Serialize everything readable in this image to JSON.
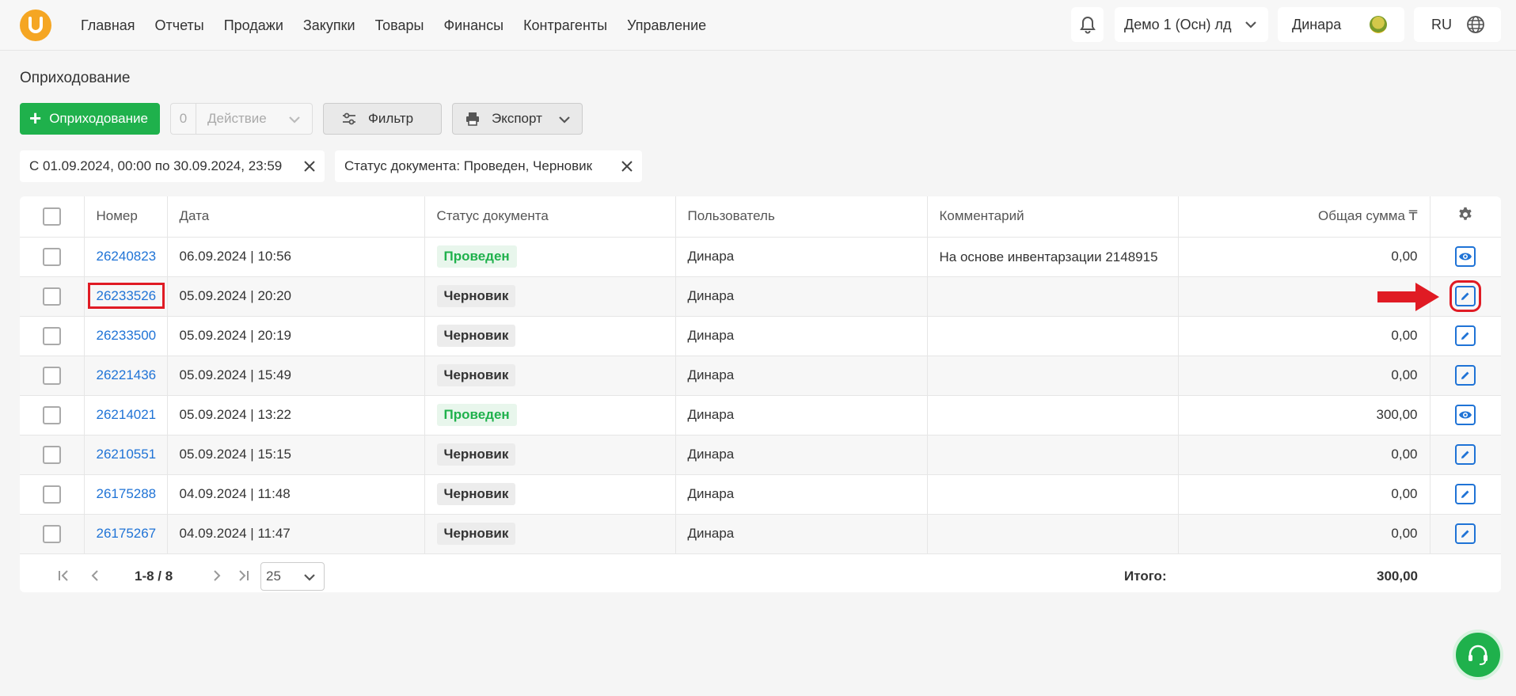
{
  "nav": {
    "items": [
      "Главная",
      "Отчеты",
      "Продажи",
      "Закупки",
      "Товары",
      "Финансы",
      "Контрагенты",
      "Управление"
    ]
  },
  "header": {
    "org_name": "Демо 1 (Осн) лд",
    "user_name": "Динара",
    "lang": "RU"
  },
  "page": {
    "title": "Оприходование"
  },
  "toolbar": {
    "add_label": "Оприходование",
    "action_count": "0",
    "action_label": "Действие",
    "filter_label": "Фильтр",
    "export_label": "Экспорт"
  },
  "filters": {
    "date_range": "С 01.09.2024, 00:00 по 30.09.2024, 23:59",
    "status": "Статус документа: Проведен, Черновик"
  },
  "table": {
    "columns": [
      "Номер",
      "Дата",
      "Статус документа",
      "Пользователь",
      "Комментарий",
      "Общая сумма ₸"
    ],
    "rows": [
      {
        "number": "26240823",
        "date": "06.09.2024 | 10:56",
        "status": "Проведен",
        "user": "Динара",
        "comment": "На основе инвентарзации 2148915",
        "amount": "0,00",
        "action": "view-icon"
      },
      {
        "number": "26233526",
        "date": "05.09.2024 | 20:20",
        "status": "Черновик",
        "user": "Динара",
        "comment": "",
        "amount": "",
        "action": "edit-icon"
      },
      {
        "number": "26233500",
        "date": "05.09.2024 | 20:19",
        "status": "Черновик",
        "user": "Динара",
        "comment": "",
        "amount": "0,00",
        "action": "edit-icon"
      },
      {
        "number": "26221436",
        "date": "05.09.2024 | 15:49",
        "status": "Черновик",
        "user": "Динара",
        "comment": "",
        "amount": "0,00",
        "action": "edit-icon"
      },
      {
        "number": "26214021",
        "date": "05.09.2024 | 13:22",
        "status": "Проведен",
        "user": "Динара",
        "comment": "",
        "amount": "300,00",
        "action": "view-icon"
      },
      {
        "number": "26210551",
        "date": "05.09.2024 | 15:15",
        "status": "Черновик",
        "user": "Динара",
        "comment": "",
        "amount": "0,00",
        "action": "edit-icon"
      },
      {
        "number": "26175288",
        "date": "04.09.2024 | 11:48",
        "status": "Черновик",
        "user": "Динара",
        "comment": "",
        "amount": "0,00",
        "action": "edit-icon"
      },
      {
        "number": "26175267",
        "date": "04.09.2024 | 11:47",
        "status": "Черновик",
        "user": "Динара",
        "comment": "",
        "amount": "0,00",
        "action": "edit-icon"
      }
    ]
  },
  "footer": {
    "range": "1-8 / 8",
    "page_size": "25",
    "total_label": "Итого:",
    "total_value": "300,00"
  },
  "colors": {
    "primary_green": "#1fb14c",
    "link_blue": "#1f73d6",
    "highlight_red": "#e01b24",
    "logo_orange": "#f5a623"
  }
}
